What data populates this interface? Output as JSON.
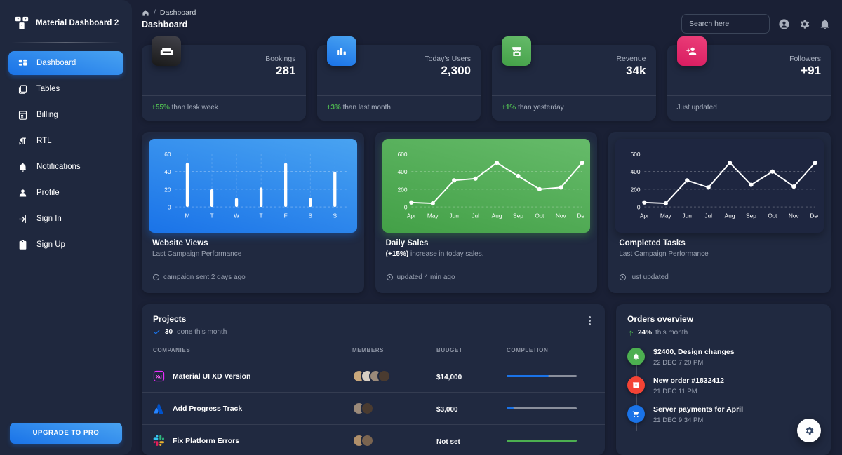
{
  "sidebar": {
    "brand": "Material Dashboard 2",
    "items": [
      {
        "label": "Dashboard",
        "icon": "dashboard-icon",
        "active": true
      },
      {
        "label": "Tables",
        "icon": "tables-icon",
        "active": false
      },
      {
        "label": "Billing",
        "icon": "billing-icon",
        "active": false
      },
      {
        "label": "RTL",
        "icon": "rtl-icon",
        "active": false
      },
      {
        "label": "Notifications",
        "icon": "bell-icon",
        "active": false
      },
      {
        "label": "Profile",
        "icon": "person-icon",
        "active": false
      },
      {
        "label": "Sign In",
        "icon": "login-icon",
        "active": false
      },
      {
        "label": "Sign Up",
        "icon": "signup-icon",
        "active": false
      }
    ],
    "upgrade_label": "UPGRADE TO PRO"
  },
  "header": {
    "breadcrumb_home": "home-icon",
    "breadcrumb_sep": "/",
    "breadcrumb_current": "Dashboard",
    "page_title": "Dashboard",
    "search_placeholder": "Search here",
    "icons": [
      "account-icon",
      "gear-icon",
      "bell-icon"
    ]
  },
  "stats": [
    {
      "label": "Bookings",
      "value": "281",
      "delta": "+55%",
      "delta_text": "than lask week",
      "delta_color": "#4caf50",
      "icon": "weekend-icon",
      "icon_bg": "dark"
    },
    {
      "label": "Today's Users",
      "value": "2,300",
      "delta": "+3%",
      "delta_text": "than last month",
      "delta_color": "#4caf50",
      "icon": "leaderboard-icon",
      "icon_bg": "blue"
    },
    {
      "label": "Revenue",
      "value": "34k",
      "delta": "+1%",
      "delta_text": "than yesterday",
      "delta_color": "#4caf50",
      "icon": "store-icon",
      "icon_bg": "green"
    },
    {
      "label": "Followers",
      "value": "+91",
      "delta": "",
      "delta_text": "Just updated",
      "delta_color": "#a8b0bf",
      "icon": "person-add-icon",
      "icon_bg": "pink"
    }
  ],
  "chart_data": [
    {
      "type": "bar",
      "title": "Website Views",
      "subtitle": "Last Campaign Performance",
      "footer": "campaign sent 2 days ago",
      "categories": [
        "M",
        "T",
        "W",
        "T",
        "F",
        "S",
        "S"
      ],
      "values": [
        50,
        20,
        10,
        22,
        50,
        10,
        40
      ],
      "yticks": [
        0,
        20,
        40,
        60
      ],
      "ylim": [
        0,
        60
      ],
      "xlabel": "",
      "ylabel": "",
      "grid": true,
      "theme": "blue"
    },
    {
      "type": "line",
      "title": "Daily Sales",
      "subtitle_prefix": "(+15%)",
      "subtitle": " increase in today sales.",
      "footer": "updated 4 min ago",
      "categories": [
        "Apr",
        "May",
        "Jun",
        "Jul",
        "Aug",
        "Sep",
        "Oct",
        "Nov",
        "Dec"
      ],
      "values": [
        50,
        40,
        300,
        320,
        500,
        350,
        200,
        220,
        500
      ],
      "yticks": [
        0,
        200,
        400,
        600
      ],
      "ylim": [
        0,
        600
      ],
      "xlabel": "",
      "ylabel": "",
      "grid": true,
      "theme": "green"
    },
    {
      "type": "line",
      "title": "Completed Tasks",
      "subtitle": "Last Campaign Performance",
      "footer": "just updated",
      "categories": [
        "Apr",
        "May",
        "Jun",
        "Jul",
        "Aug",
        "Sep",
        "Oct",
        "Nov",
        "Dec"
      ],
      "values": [
        50,
        40,
        300,
        220,
        500,
        250,
        400,
        230,
        500
      ],
      "yticks": [
        0,
        200,
        400,
        600
      ],
      "ylim": [
        0,
        600
      ],
      "xlabel": "",
      "ylabel": "",
      "grid": true,
      "theme": "dark"
    }
  ],
  "projects": {
    "title": "Projects",
    "done_count": "30",
    "done_text": "done this month",
    "columns": [
      "COMPANIES",
      "MEMBERS",
      "BUDGET",
      "COMPLETION"
    ],
    "rows": [
      {
        "name": "Material UI XD Version",
        "logo": "xd-icon",
        "members": 4,
        "budget": "$14,000",
        "completion": 60,
        "bar_color": "#1A73E8"
      },
      {
        "name": "Add Progress Track",
        "logo": "atlassian-icon",
        "members": 2,
        "budget": "$3,000",
        "completion": 10,
        "bar_color": "#1A73E8"
      },
      {
        "name": "Fix Platform Errors",
        "logo": "slack-icon",
        "members": 2,
        "budget": "Not set",
        "completion": 100,
        "bar_color": "#4CAF50"
      }
    ]
  },
  "orders": {
    "title": "Orders overview",
    "growth": "24%",
    "growth_text": "this month",
    "items": [
      {
        "title": "$2400, Design changes",
        "time": "22 DEC 7:20 PM",
        "color": "#4CAF50",
        "icon": "bell-icon"
      },
      {
        "title": "New order #1832412",
        "time": "21 DEC 11 PM",
        "color": "#F44335",
        "icon": "inventory-icon"
      },
      {
        "title": "Server payments for April",
        "time": "21 DEC 9:34 PM",
        "color": "#1A73E8",
        "icon": "cart-icon"
      }
    ],
    "fab_icon": "gear-icon"
  }
}
